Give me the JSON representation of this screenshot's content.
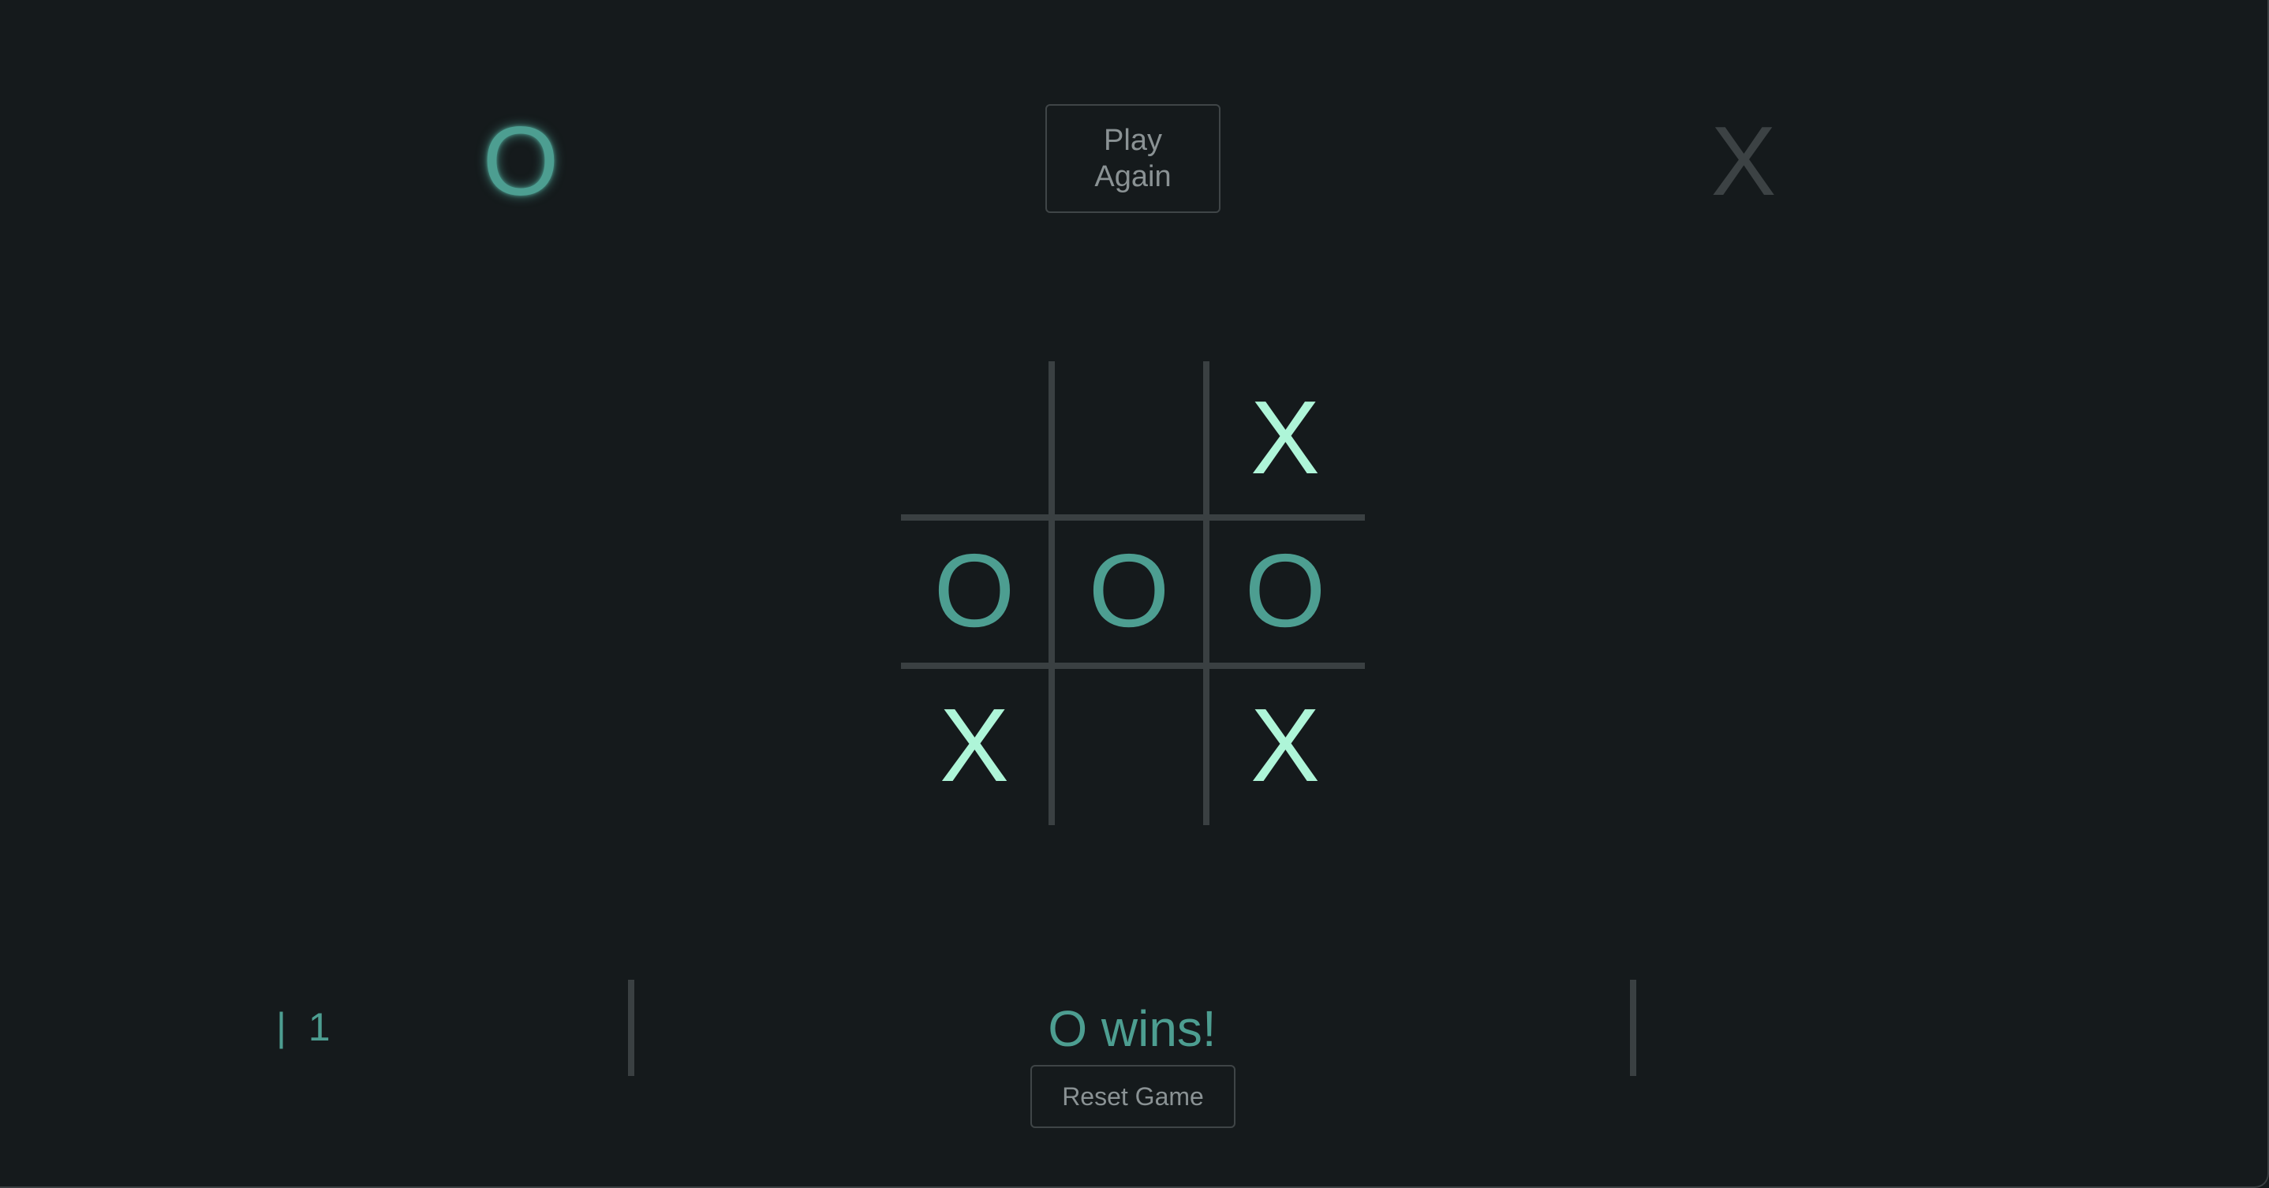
{
  "header": {
    "player_o": "O",
    "player_x": "X",
    "play_again_label": "Play Again",
    "active_player": "O"
  },
  "board": {
    "cells": [
      "",
      "",
      "X",
      "O",
      "O",
      "O",
      "X",
      "",
      "X"
    ]
  },
  "footer": {
    "score": "|  1",
    "status": "O wins!",
    "reset_label": "Reset Game"
  },
  "colors": {
    "background": "#151a1c",
    "o_mark": "#4d9e91",
    "x_mark": "#aef5d8",
    "inactive": "#3c4244",
    "grid": "#3a4042"
  }
}
